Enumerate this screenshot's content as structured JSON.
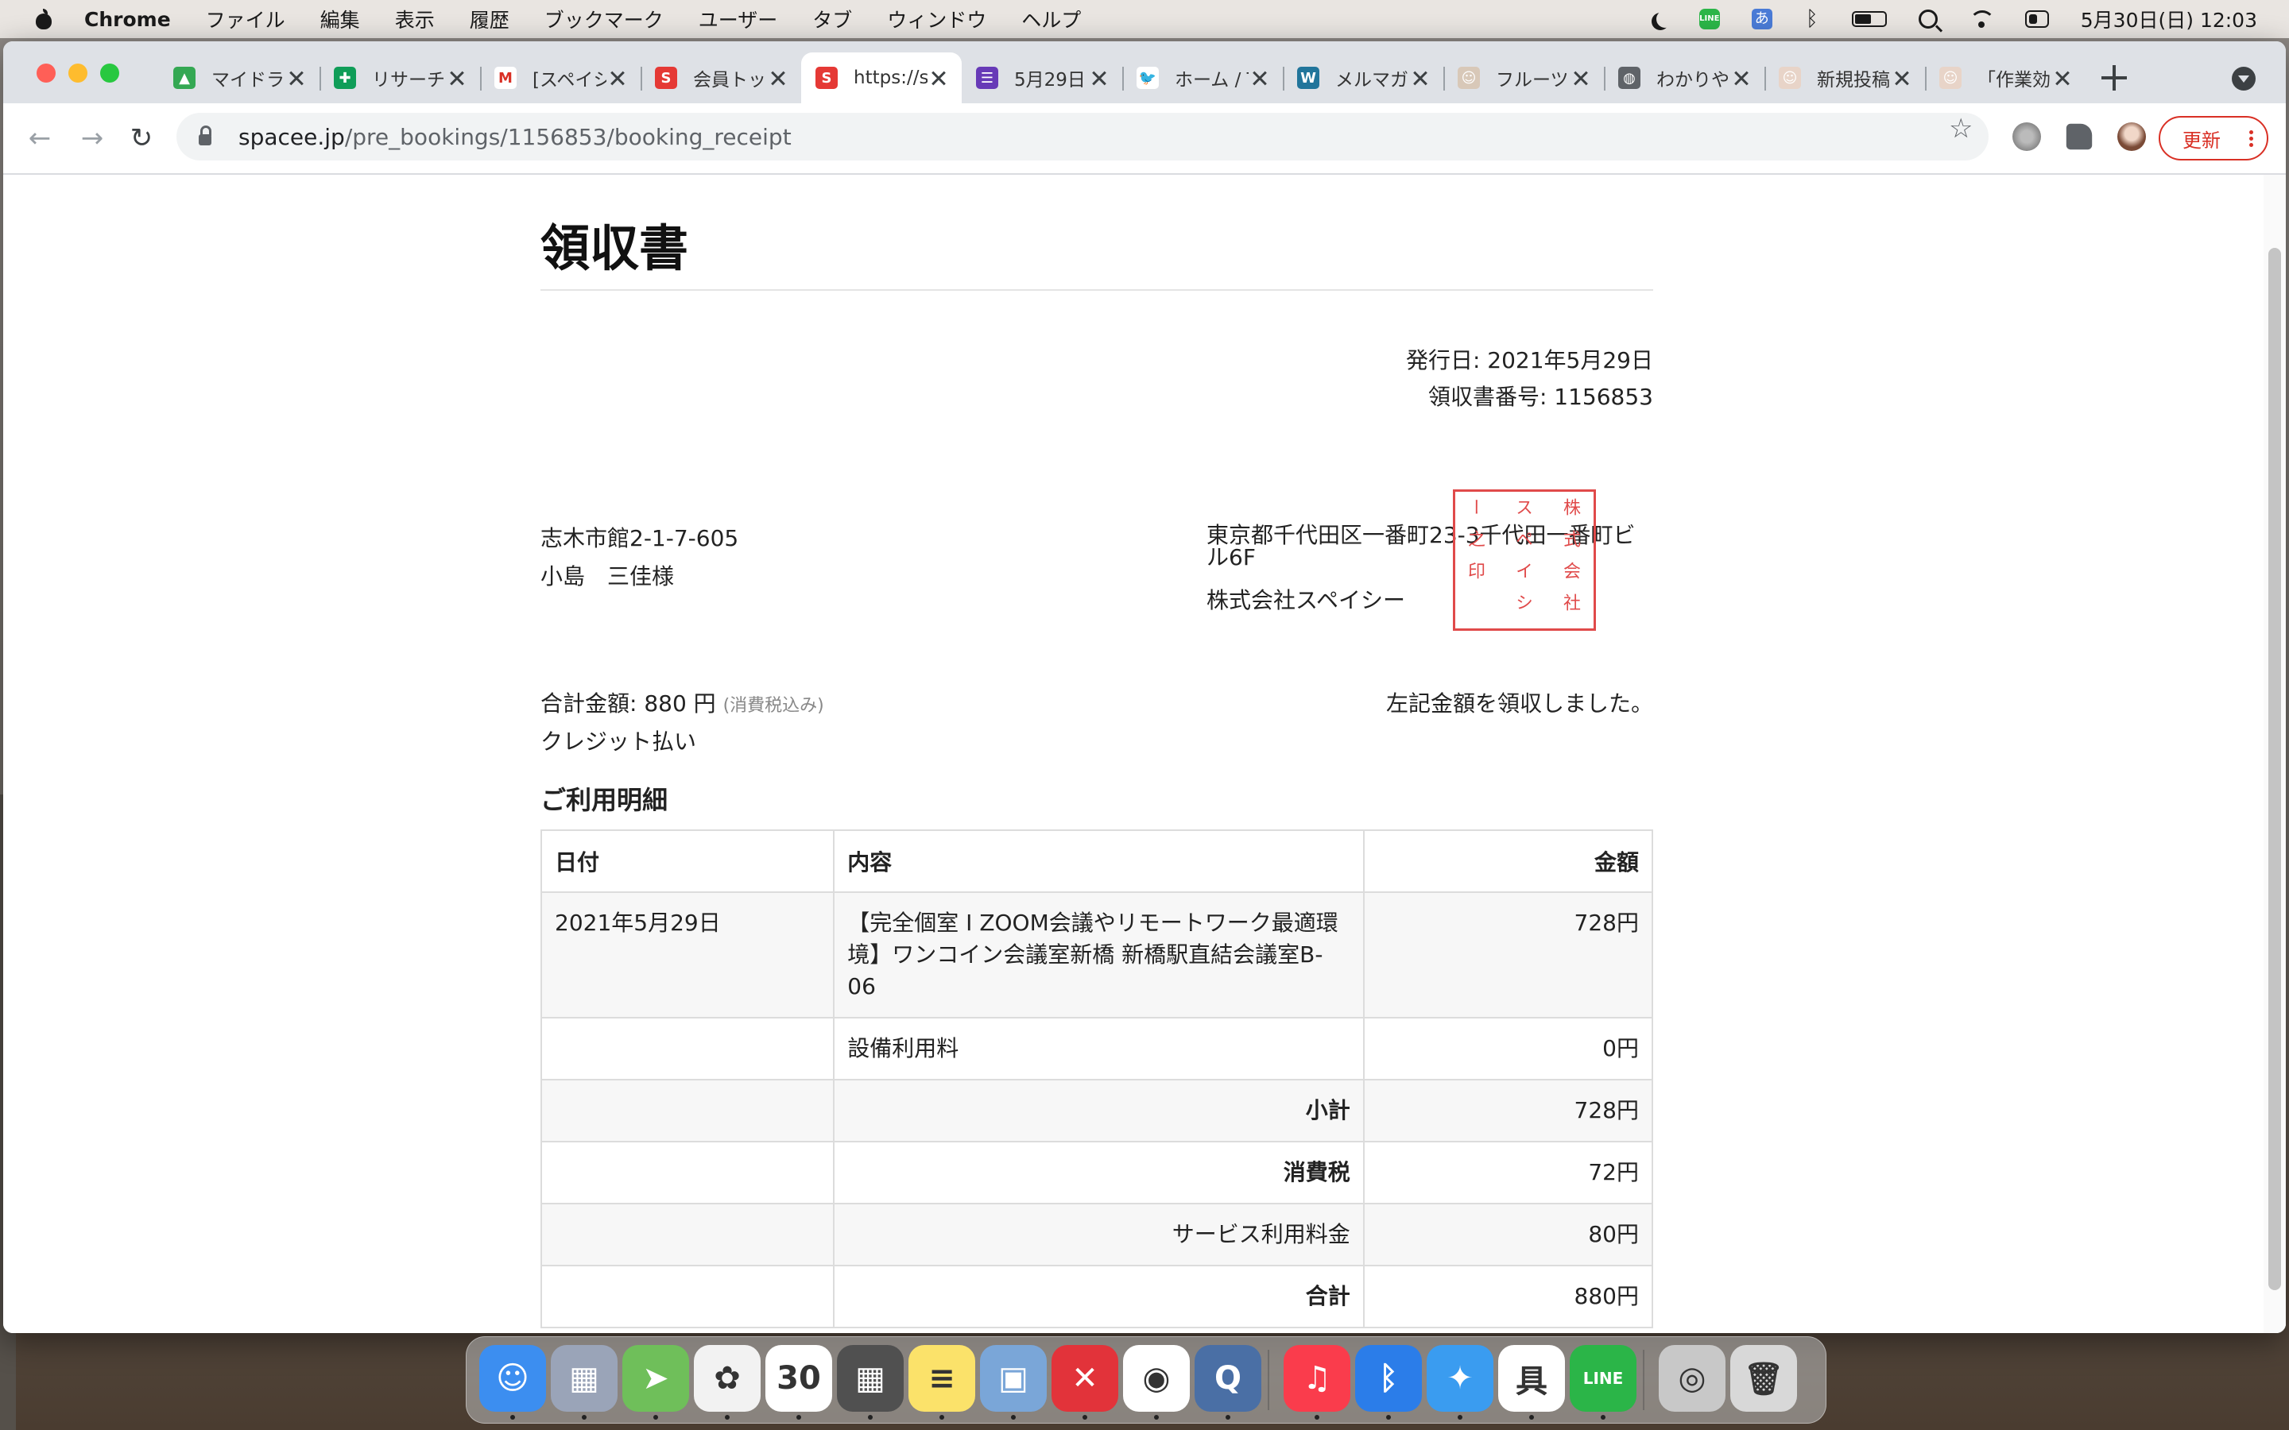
{
  "menubar": {
    "app_name": "Chrome",
    "items": [
      "ファイル",
      "編集",
      "表示",
      "履歴",
      "ブックマーク",
      "ユーザー",
      "タブ",
      "ウィンドウ",
      "ヘルプ"
    ],
    "line_label": "LINE",
    "ime_label": "あ",
    "battery_level": 0.55,
    "clock": "5月30日(日)  12:03"
  },
  "browser": {
    "tabs": [
      {
        "title": "マイドライブ",
        "icon": "google-drive-icon",
        "color": "#34a853",
        "glyph": "▲"
      },
      {
        "title": "リサーチ",
        "icon": "google-sheets-icon",
        "color": "#0f9d58",
        "glyph": "✚"
      },
      {
        "title": "[スペイシー]",
        "icon": "gmail-icon",
        "color": "#ffffff",
        "glyph": "M"
      },
      {
        "title": "会員トップ",
        "icon": "spacee-icon",
        "color": "#e53935",
        "glyph": "S"
      },
      {
        "title": "https://spacee.jp",
        "icon": "spacee-icon",
        "color": "#e53935",
        "glyph": "S"
      },
      {
        "title": "5月29日",
        "icon": "forms-icon",
        "color": "#673ab7",
        "glyph": "☰"
      },
      {
        "title": "ホーム / Twitter",
        "icon": "twitter-icon",
        "color": "#ffffff",
        "glyph": "🐦"
      },
      {
        "title": "メルマガ",
        "icon": "wordpress-icon",
        "color": "#21759b",
        "glyph": "W"
      },
      {
        "title": "フルーツ",
        "icon": "avatar-icon",
        "color": "#d8c8b8",
        "glyph": "☺"
      },
      {
        "title": "わかりやすい",
        "icon": "globe-icon",
        "color": "#5f6368",
        "glyph": "◍"
      },
      {
        "title": "新規投稿",
        "icon": "avatar-icon",
        "color": "#e8d4c8",
        "glyph": "☺"
      },
      {
        "title": "「作業効率",
        "icon": "avatar-icon",
        "color": "#e8d4c8",
        "glyph": "☺"
      }
    ],
    "active_tab": 4,
    "url_domain": "spacee.jp",
    "url_path": "/pre_bookings/1156853/booking_receipt",
    "update_label": "更新"
  },
  "receipt": {
    "title": "領収書",
    "issue_date": "発行日: 2021年5月29日",
    "receipt_number": "領収書番号: 1156853",
    "customer_address": "志木市館2-1-7-605",
    "customer_name": "小島　三佳様",
    "company_address": "東京都千代田区一番町23-3千代田一番町ビル6F",
    "company_name": "株式会社スペイシー",
    "seal_text": "株式会社スペイシー之印",
    "total_label": "合計金額: 880 円",
    "tax_note": "(消費税込み)",
    "received_text": "左記金額を領収しました。",
    "payment_method": "クレジット払い",
    "details_heading": "ご利用明細",
    "table": {
      "headers": [
        "日付",
        "内容",
        "金額"
      ],
      "rows": [
        {
          "date": "2021年5月29日",
          "content": "【完全個室 I ZOOM会議やリモートワーク最適環境】ワンコイン会議室新橋 新橋駅直結会議室B-06",
          "amount": "728円"
        },
        {
          "date": "",
          "content": "設備利用料",
          "amount": "0円"
        },
        {
          "date": "",
          "content": "小計",
          "amount": "728円"
        },
        {
          "date": "",
          "content": "消費税",
          "amount": "72円"
        },
        {
          "date": "",
          "content": "サービス利用料金",
          "amount": "80円"
        },
        {
          "date": "",
          "content": "合計",
          "amount": "880円"
        }
      ]
    }
  },
  "dock": {
    "apps": [
      {
        "name": "finder-icon",
        "color": "#3c8ef0",
        "glyph": "☺"
      },
      {
        "name": "launchpad-icon",
        "color": "#9aa4b8",
        "glyph": "▦"
      },
      {
        "name": "maps-icon",
        "color": "#6fbf5a",
        "glyph": "➤"
      },
      {
        "name": "photos-icon",
        "color": "#f2f2f2",
        "glyph": "✿"
      },
      {
        "name": "calendar-icon",
        "color": "#ffffff",
        "glyph": "30"
      },
      {
        "name": "calculator-icon",
        "color": "#505050",
        "glyph": "▦"
      },
      {
        "name": "notes-icon",
        "color": "#fbe26a",
        "glyph": "≡"
      },
      {
        "name": "preview-icon",
        "color": "#7aa6d8",
        "glyph": "▣"
      },
      {
        "name": "xmind-icon",
        "color": "#e2333a",
        "glyph": "✕"
      },
      {
        "name": "chrome-icon",
        "color": "#ffffff",
        "glyph": "◉"
      },
      {
        "name": "quicktime-icon",
        "color": "#4a6fa5",
        "glyph": "Q"
      },
      {
        "name": "music-icon",
        "color": "#fa3c4c",
        "glyph": "♫"
      },
      {
        "name": "bluetooth-icon",
        "color": "#2b7de9",
        "glyph": "ᛒ"
      },
      {
        "name": "safari-icon",
        "color": "#3a9cf0",
        "glyph": "✦"
      },
      {
        "name": "sensei-icon",
        "color": "#ffffff",
        "glyph": "具"
      },
      {
        "name": "line-icon",
        "color": "#2bb548",
        "glyph": "LINE"
      },
      {
        "name": "downloads-icon",
        "color": "#c8c8c8",
        "glyph": "◎"
      },
      {
        "name": "trash-icon",
        "color": "#d8d8d8",
        "glyph": "🗑"
      }
    ]
  }
}
